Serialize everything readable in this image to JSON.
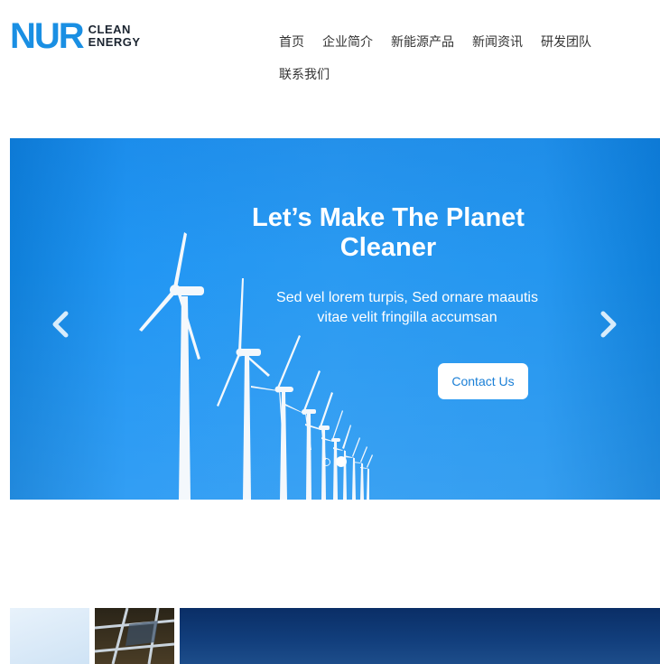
{
  "brand": {
    "mark": "NUR",
    "line1": "CLEAN",
    "line2": "ENERGY",
    "color": "#1a8fe3"
  },
  "nav": {
    "items": [
      {
        "label": "首页"
      },
      {
        "label": "企业简介"
      },
      {
        "label": "新能源产品"
      },
      {
        "label": "新闻资讯"
      },
      {
        "label": "研发团队"
      },
      {
        "label": "联系我们"
      }
    ]
  },
  "hero": {
    "title": "Let’s Make The Planet Cleaner",
    "subtitle": "Sed vel lorem turpis, Sed ornare maautis vitae velit fringilla accumsan",
    "button": "Contact Us",
    "prev_icon": "chevron-left-icon",
    "next_icon": "chevron-right-icon",
    "slide_count": 2,
    "active_slide": 2,
    "bg_color": "#2196f3"
  },
  "thumbnails": [
    {
      "name": "sky-thumbnail"
    },
    {
      "name": "solar-panel-thumbnail"
    },
    {
      "name": "night-sky-thumbnail"
    }
  ]
}
